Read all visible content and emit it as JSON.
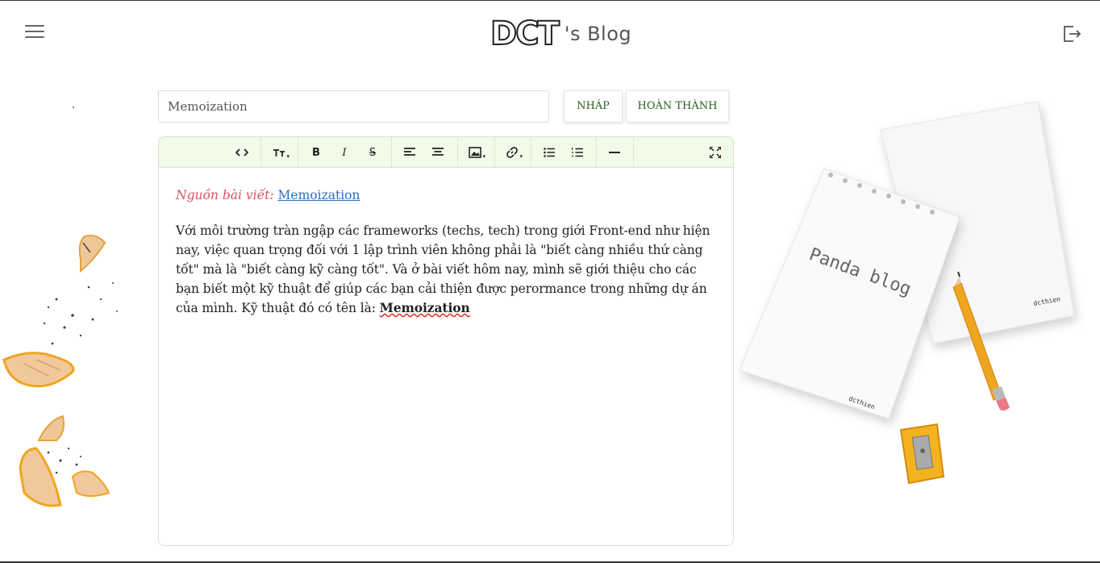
{
  "header": {
    "logo_mark": "DCT",
    "logo_text": "'s Blog",
    "menu_icon": "hamburger-icon",
    "logout_icon": "logout-icon"
  },
  "post": {
    "title_value": "Memoization",
    "title_placeholder": "Memoization",
    "draft_label": "NHÁP",
    "done_label": "HOÀN THÀNH"
  },
  "toolbar": {
    "code": "<>",
    "font_size": "TT",
    "bold": "B",
    "italic": "I",
    "strike": "S"
  },
  "content": {
    "source_label": "Nguồn bài viết:",
    "source_link": "Memoization",
    "paragraph": "Với môi trường tràn ngập các frameworks (techs, tech) trong giới Front-end như hiện nay, việc quan trọng đối với 1 lập trình viên không phải là \"biết càng nhiều thứ càng tốt\" mà là \"biết càng kỹ càng tốt\". Và ở bài viết hôm nay, mình sẽ giới thiệu cho các bạn biết một kỹ thuật để giúp các bạn cải thiện được perormance trong những dự án của mình. Kỹ thuật đó có tên là: ",
    "paragraph_bold": "Memoization"
  },
  "decor": {
    "notebook_text": "Panda blog",
    "notebook_sign": "dcthien",
    "notebook_sign2": "dcthien"
  },
  "colors": {
    "toolbar_bg": "#f1fbe7",
    "button_text": "#2d5a1e",
    "source_label": "#d9505f",
    "link": "#2a6fc9"
  }
}
